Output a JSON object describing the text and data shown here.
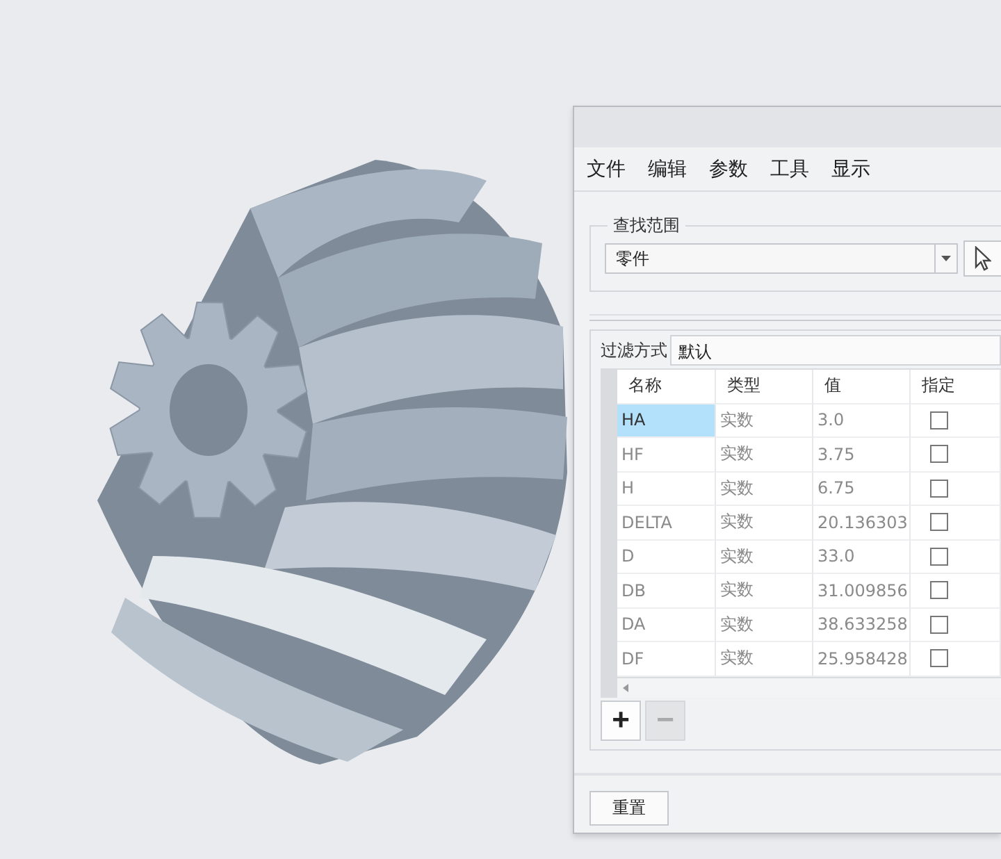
{
  "menu": [
    "文件",
    "编辑",
    "参数",
    "工具",
    "显示"
  ],
  "search_scope": {
    "legend": "查找范围",
    "value": "零件"
  },
  "filter": {
    "label": "过滤方式",
    "value": "默认"
  },
  "table": {
    "columns": [
      "名称",
      "类型",
      "值",
      "指定"
    ],
    "rows": [
      {
        "name": "HA",
        "type": "实数",
        "value": "3.0",
        "checked": false,
        "selected": true
      },
      {
        "name": "HF",
        "type": "实数",
        "value": "3.75",
        "checked": false,
        "selected": false
      },
      {
        "name": "H",
        "type": "实数",
        "value": "6.75",
        "checked": false,
        "selected": false
      },
      {
        "name": "DELTA",
        "type": "实数",
        "value": "20.136303",
        "checked": false,
        "selected": false
      },
      {
        "name": "D",
        "type": "实数",
        "value": "33.0",
        "checked": false,
        "selected": false
      },
      {
        "name": "DB",
        "type": "实数",
        "value": "31.009856",
        "checked": false,
        "selected": false
      },
      {
        "name": "DA",
        "type": "实数",
        "value": "38.633258",
        "checked": false,
        "selected": false
      },
      {
        "name": "DF",
        "type": "实数",
        "value": "25.958428",
        "checked": false,
        "selected": false
      }
    ]
  },
  "add_button": {
    "label": "+",
    "disabled": false
  },
  "remove_button": {
    "label": "−",
    "disabled": true
  },
  "reset_button": "重置"
}
